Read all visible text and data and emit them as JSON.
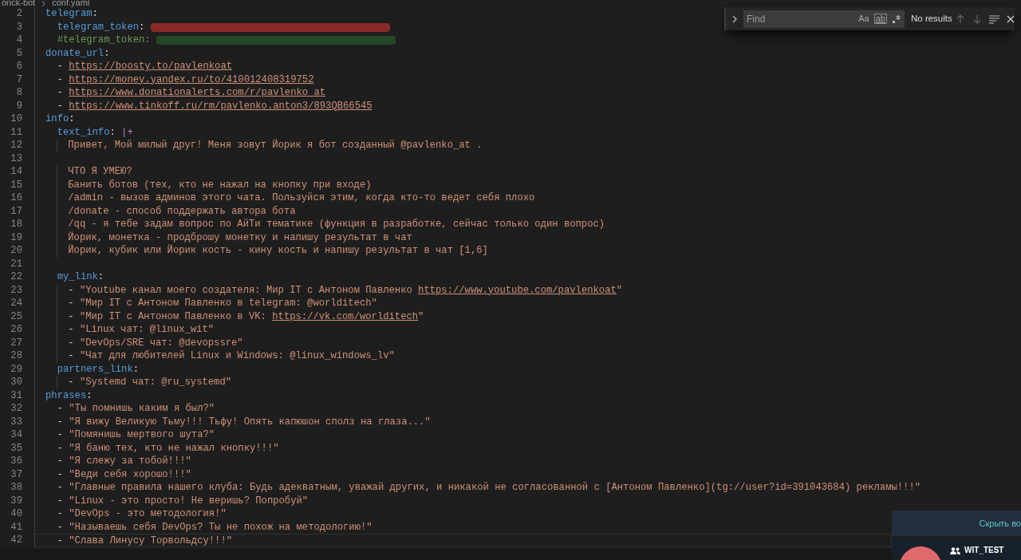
{
  "breadcrumb": [
    "orick-bot",
    "conf.yaml"
  ],
  "find": {
    "placeholder": "Find",
    "toggles": [
      "Aa",
      "ab"
    ],
    "results": "No results"
  },
  "lines": [
    {
      "number": "2",
      "current": false,
      "segments": [
        {
          "kind": "key",
          "text": "telegram"
        },
        {
          "kind": "punct",
          "text": ":"
        }
      ]
    },
    {
      "number": "3",
      "current": false,
      "segments": [
        {
          "kind": "key",
          "text": "  telegram_token"
        },
        {
          "kind": "punct",
          "text": ": "
        },
        {
          "kind": "redacted",
          "color": "#8a2a2a"
        }
      ]
    },
    {
      "number": "4",
      "current": false,
      "segments": [
        {
          "kind": "comment",
          "text": "  #telegram_token: "
        },
        {
          "kind": "redacted",
          "color": "#24472a"
        }
      ]
    },
    {
      "number": "5",
      "current": false,
      "segments": [
        {
          "kind": "key",
          "text": "donate_url"
        },
        {
          "kind": "punct",
          "text": ":"
        }
      ]
    },
    {
      "number": "6",
      "current": false,
      "segments": [
        {
          "kind": "punct",
          "text": "  - "
        },
        {
          "kind": "link",
          "text": "https://boosty.to/pavlenkoat"
        }
      ]
    },
    {
      "number": "7",
      "current": false,
      "segments": [
        {
          "kind": "punct",
          "text": "  - "
        },
        {
          "kind": "link",
          "text": "https://money.yandex.ru/to/410012408319752"
        }
      ]
    },
    {
      "number": "8",
      "current": false,
      "segments": [
        {
          "kind": "punct",
          "text": "  - "
        },
        {
          "kind": "link",
          "text": "https://www.donationalerts.com/r/pavlenko_at"
        }
      ]
    },
    {
      "number": "9",
      "current": false,
      "segments": [
        {
          "kind": "punct",
          "text": "  - "
        },
        {
          "kind": "link",
          "text": "https://www.tinkoff.ru/rm/pavlenko.anton3/893QB66545"
        }
      ]
    },
    {
      "number": "10",
      "current": false,
      "segments": [
        {
          "kind": "key",
          "text": "info"
        },
        {
          "kind": "punct",
          "text": ":"
        }
      ]
    },
    {
      "number": "11",
      "current": false,
      "segments": [
        {
          "kind": "key",
          "text": "  text_info"
        },
        {
          "kind": "punct",
          "text": ": "
        },
        {
          "kind": "indicator",
          "text": "|+"
        }
      ]
    },
    {
      "number": "12",
      "current": false,
      "segments": [
        {
          "kind": "plain",
          "text": "    Привет, Мой милый друг! Меня зовут Йорик я бот созданный @pavlenko_at ."
        }
      ]
    },
    {
      "number": "13",
      "current": false
    },
    {
      "number": "14",
      "current": false,
      "segments": [
        {
          "kind": "plain",
          "text": "    ЧТО Я УМЕЮ?"
        }
      ]
    },
    {
      "number": "15",
      "current": false,
      "segments": [
        {
          "kind": "plain",
          "text": "    Банить ботов (тех, кто не нажал на кнопку при входе)"
        }
      ]
    },
    {
      "number": "16",
      "current": false,
      "segments": [
        {
          "kind": "plain",
          "text": "    /admin - вызов админов этого чата. Пользуйся этим, когда кто-то ведет себя плохо"
        }
      ]
    },
    {
      "number": "17",
      "current": false,
      "segments": [
        {
          "kind": "plain",
          "text": "    /donate - способ поддержать автора бота"
        }
      ]
    },
    {
      "number": "18",
      "current": false,
      "segments": [
        {
          "kind": "plain",
          "text": "    /qq - я тебе задам вопрос по АйТи тематике (функция в разработке, сейчас только один вопрос)"
        }
      ]
    },
    {
      "number": "19",
      "current": false,
      "segments": [
        {
          "kind": "plain",
          "text": "    Йорик, монетка - продброшу монетку и напишу результат в чат"
        }
      ]
    },
    {
      "number": "20",
      "current": false,
      "segments": [
        {
          "kind": "plain",
          "text": "    Йорик, кубик или Йорик кость - кину кость и напишу результат в чат [1,6]"
        }
      ]
    },
    {
      "number": "21",
      "current": false
    },
    {
      "number": "22",
      "current": false,
      "segments": [
        {
          "kind": "key",
          "text": "  my_link"
        },
        {
          "kind": "punct",
          "text": ":"
        }
      ]
    },
    {
      "number": "23",
      "current": false,
      "segments": [
        {
          "kind": "punct",
          "text": "    - "
        },
        {
          "kind": "string",
          "text": "\"Youtube канал моего создателя: Мир IT с Антоном Павленко "
        },
        {
          "kind": "link",
          "text": "https://www.youtube.com/pavlenkoat"
        },
        {
          "kind": "string",
          "text": "\""
        }
      ]
    },
    {
      "number": "24",
      "current": false,
      "segments": [
        {
          "kind": "punct",
          "text": "    - "
        },
        {
          "kind": "string",
          "text": "\"Мир IT с Антоном Павленко в telegram: @worlditech\""
        }
      ]
    },
    {
      "number": "25",
      "current": false,
      "segments": [
        {
          "kind": "punct",
          "text": "    - "
        },
        {
          "kind": "string",
          "text": "\"Мир IT с Антоном Павленко в VK: "
        },
        {
          "kind": "link",
          "text": "https://vk.com/worlditech"
        },
        {
          "kind": "string",
          "text": "\""
        }
      ]
    },
    {
      "number": "26",
      "current": false,
      "segments": [
        {
          "kind": "punct",
          "text": "    - "
        },
        {
          "kind": "string",
          "text": "\"Linux чат: @linux_wit\""
        }
      ]
    },
    {
      "number": "27",
      "current": false,
      "segments": [
        {
          "kind": "punct",
          "text": "    - "
        },
        {
          "kind": "string",
          "text": "\"DevOps/SRE чат: @devopssre\""
        }
      ]
    },
    {
      "number": "28",
      "current": false,
      "segments": [
        {
          "kind": "punct",
          "text": "    - "
        },
        {
          "kind": "string",
          "text": "\"Чат для любителей Linux и Windows: @linux_windows_lv\""
        }
      ]
    },
    {
      "number": "29",
      "current": false,
      "segments": [
        {
          "kind": "key",
          "text": "  partners_link"
        },
        {
          "kind": "punct",
          "text": ":"
        }
      ]
    },
    {
      "number": "30",
      "current": false,
      "segments": [
        {
          "kind": "punct",
          "text": "    - "
        },
        {
          "kind": "string",
          "text": "\"Systemd чат: @ru_systemd\""
        }
      ]
    },
    {
      "number": "31",
      "current": false,
      "segments": [
        {
          "kind": "key",
          "text": "phrases"
        },
        {
          "kind": "punct",
          "text": ":"
        }
      ]
    },
    {
      "number": "32",
      "current": false,
      "segments": [
        {
          "kind": "punct",
          "text": "  - "
        },
        {
          "kind": "string",
          "text": "\"Ты помнишь каким я был?\""
        }
      ]
    },
    {
      "number": "33",
      "current": false,
      "segments": [
        {
          "kind": "punct",
          "text": "  - "
        },
        {
          "kind": "string",
          "text": "\"Я вижу Великую Тьму!!! Тьфу! Опять капюшон сполз на глаза...\""
        }
      ]
    },
    {
      "number": "34",
      "current": false,
      "segments": [
        {
          "kind": "punct",
          "text": "  - "
        },
        {
          "kind": "string",
          "text": "\"Помянишь мертвого шута?\""
        }
      ]
    },
    {
      "number": "35",
      "current": false,
      "segments": [
        {
          "kind": "punct",
          "text": "  - "
        },
        {
          "kind": "string",
          "text": "\"Я баню тех, кто не нажал кнопку!!!\""
        }
      ]
    },
    {
      "number": "36",
      "current": false,
      "segments": [
        {
          "kind": "punct",
          "text": "  - "
        },
        {
          "kind": "string",
          "text": "\"Я слежу за тобой!!!\""
        }
      ]
    },
    {
      "number": "37",
      "current": false,
      "segments": [
        {
          "kind": "punct",
          "text": "  - "
        },
        {
          "kind": "string",
          "text": "\"Веди себя хорошо!!!\""
        }
      ]
    },
    {
      "number": "38",
      "current": false,
      "segments": [
        {
          "kind": "punct",
          "text": "  - "
        },
        {
          "kind": "string",
          "text": "\"Главные правила нашего клуба: Будь адекватным, уважай других, и никакой не согласованной с [Антоном Павленко](tg://user?id=391043684) рекламы!!!\""
        }
      ]
    },
    {
      "number": "39",
      "current": false,
      "segments": [
        {
          "kind": "punct",
          "text": "  - "
        },
        {
          "kind": "string",
          "text": "\"Linux - это просто! Не веришь? Попробуй\""
        }
      ]
    },
    {
      "number": "40",
      "current": false,
      "segments": [
        {
          "kind": "punct",
          "text": "  - "
        },
        {
          "kind": "string",
          "text": "\"DevOps - это методология!\""
        }
      ]
    },
    {
      "number": "41",
      "current": false,
      "segments": [
        {
          "kind": "punct",
          "text": "  - "
        },
        {
          "kind": "string",
          "text": "\"Называешь себя DevOps? Ты не похож на методологию!\""
        }
      ]
    },
    {
      "number": "42",
      "current": true,
      "segments": [
        {
          "kind": "punct",
          "text": "  - "
        },
        {
          "kind": "string",
          "text": "\"Слава Линусу Торвольдсу!!!\""
        }
      ]
    }
  ],
  "notification": {
    "action": "Скрыть во",
    "chat": "WIT_TEST"
  }
}
